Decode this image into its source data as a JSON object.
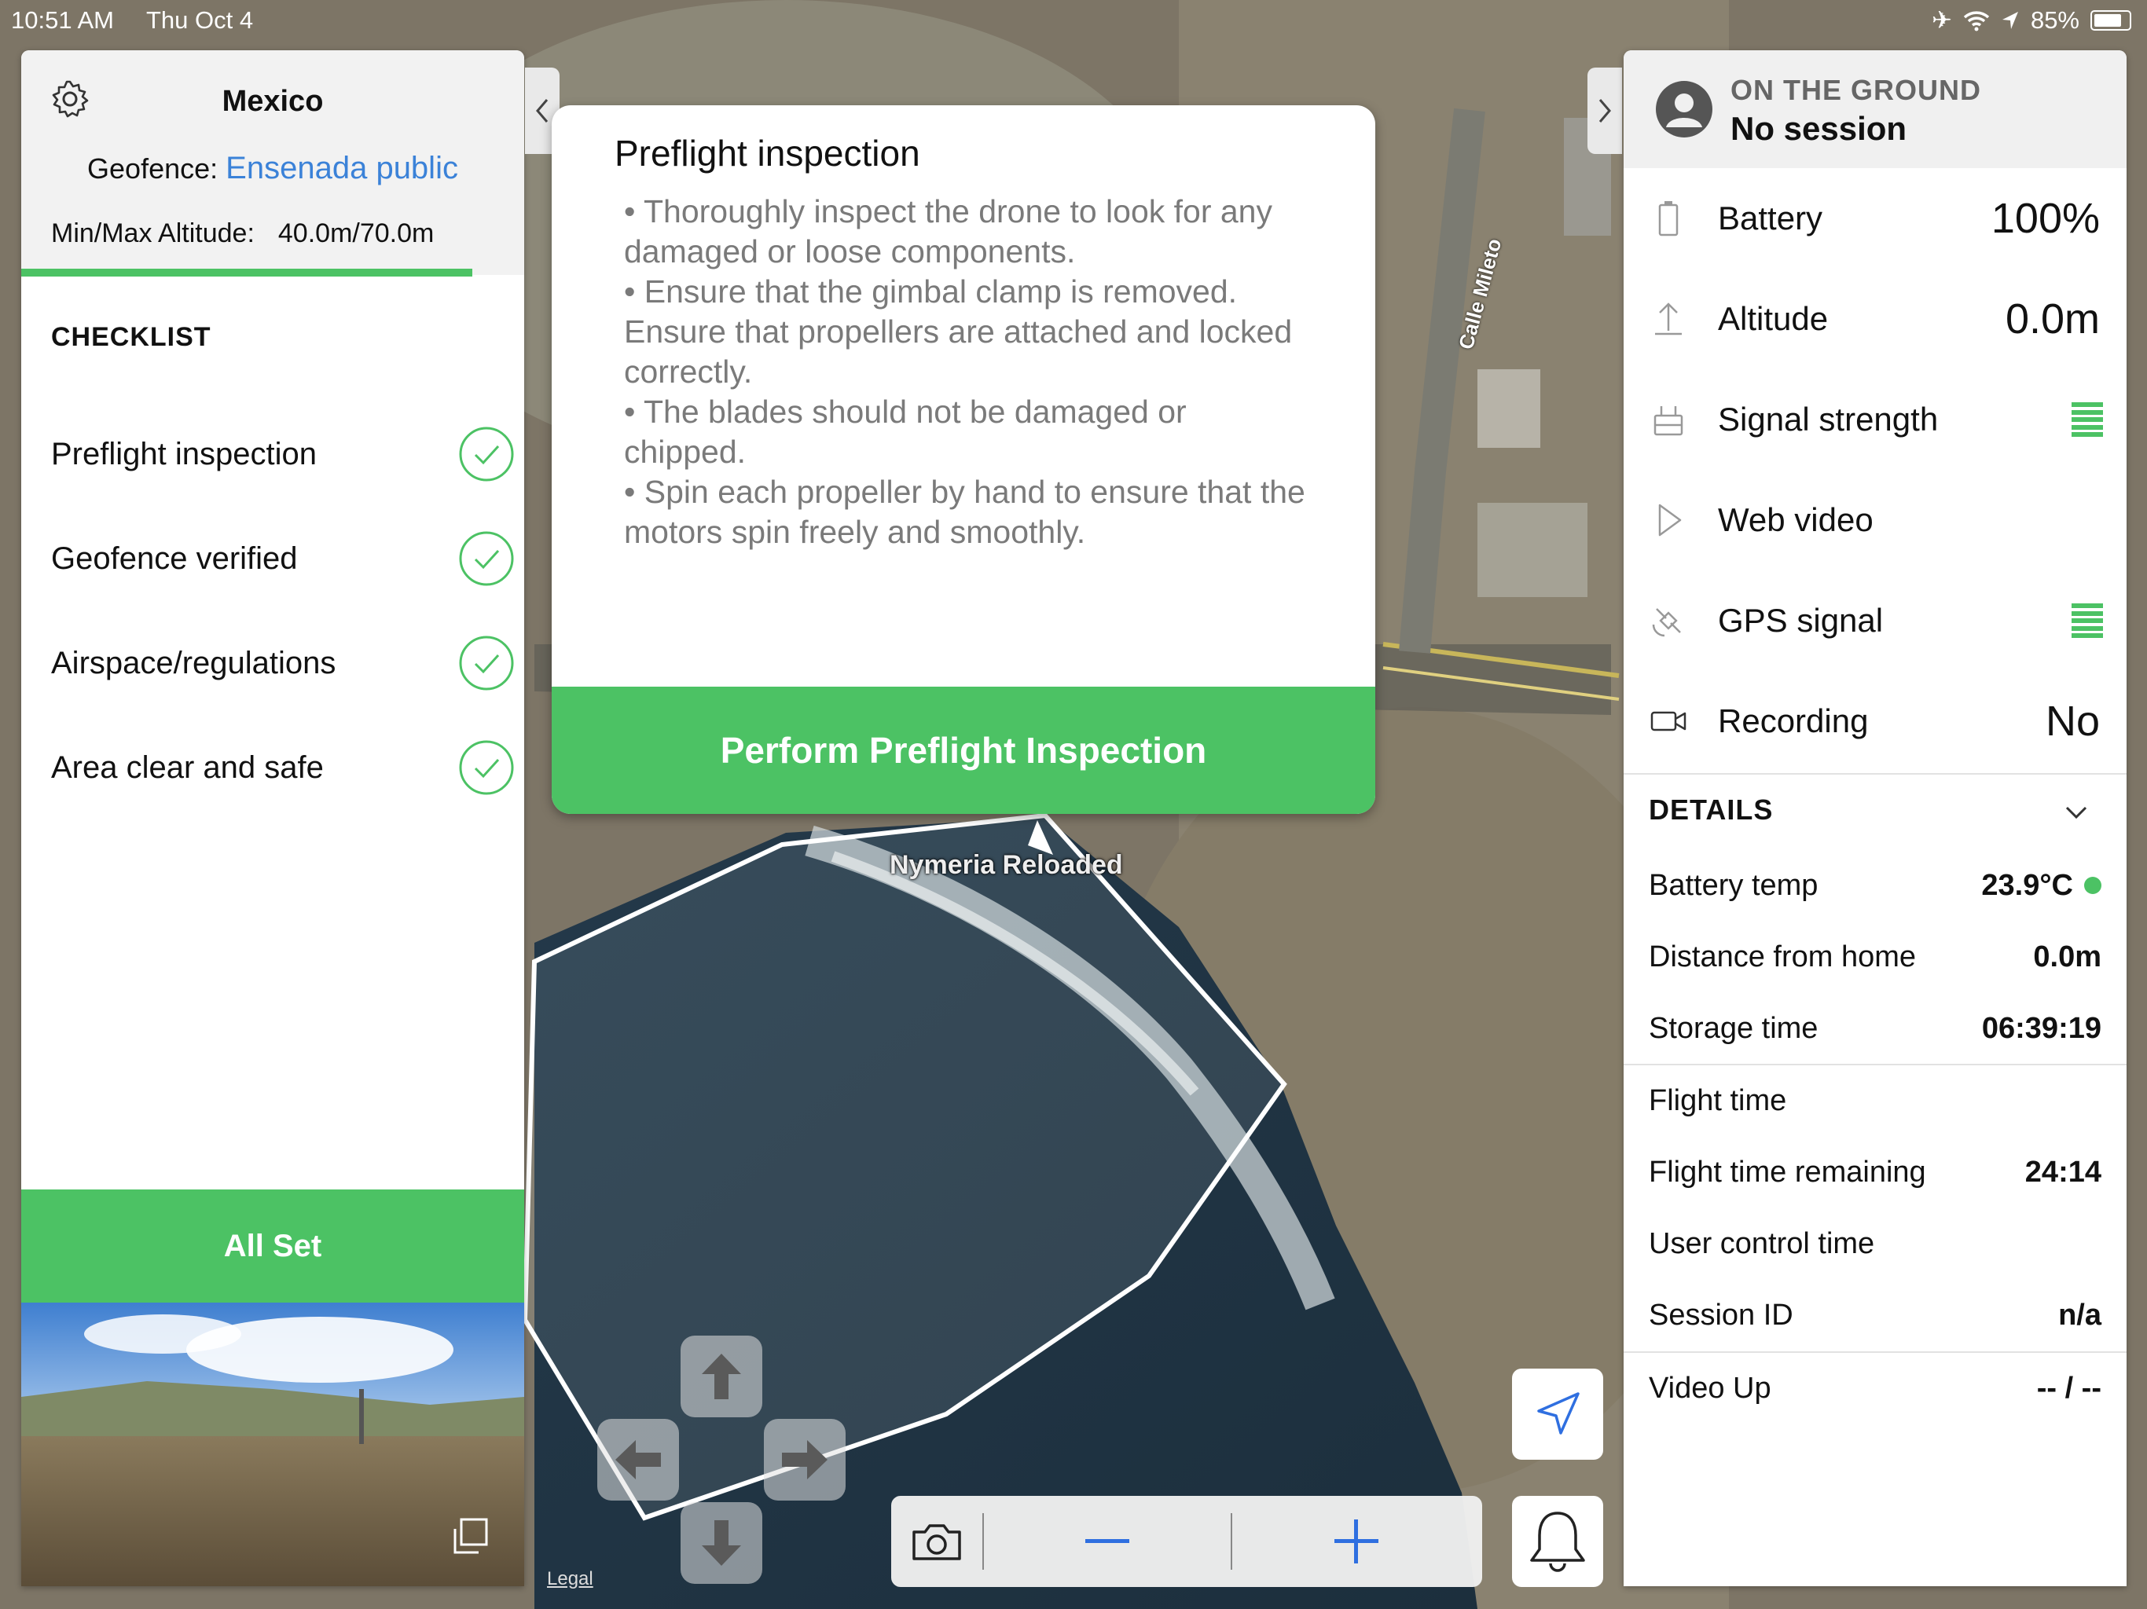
{
  "status_bar": {
    "time": "10:51 AM",
    "date": "Thu Oct 4",
    "battery": "85%"
  },
  "map": {
    "drone_label": "Nymeria Reloaded",
    "street_label": "Calle Mileto",
    "legal": "Legal"
  },
  "left_panel": {
    "title": "Mexico",
    "geofence_label": "Geofence:",
    "geofence_value": "Ensenada public",
    "altitude_label": "Min/Max Altitude:",
    "altitude_value": "40.0m/70.0m",
    "checklist_heading": "CHECKLIST",
    "checklist": [
      {
        "label": "Preflight inspection",
        "checked": true
      },
      {
        "label": "Geofence verified",
        "checked": true
      },
      {
        "label": "Airspace/regulations",
        "checked": true
      },
      {
        "label": "Area clear and safe",
        "checked": true
      }
    ],
    "all_set": "All Set"
  },
  "modal": {
    "title": "Preflight inspection",
    "lines": [
      "• Thoroughly inspect the drone to look for any damaged or loose components.",
      "• Ensure that the gimbal clamp is removed. Ensure that propellers are attached and locked correctly.",
      "• The blades should not be damaged or chipped.",
      "• Spin each propeller by hand to ensure that the motors spin freely and smoothly."
    ],
    "button": "Perform Preflight Inspection"
  },
  "right_panel": {
    "state": "ON THE GROUND",
    "session": "No session",
    "stats": [
      {
        "icon": "battery-icon",
        "label": "Battery",
        "value": "100%"
      },
      {
        "icon": "altitude-icon",
        "label": "Altitude",
        "value": "0.0m"
      },
      {
        "icon": "signal-icon",
        "label": "Signal strength",
        "value": ""
      },
      {
        "icon": "play-icon",
        "label": "Web video",
        "value": ""
      },
      {
        "icon": "gps-icon",
        "label": "GPS signal",
        "value": ""
      },
      {
        "icon": "video-camera-icon",
        "label": "Recording",
        "value": "No"
      }
    ],
    "details_heading": "DETAILS",
    "details": [
      {
        "label": "Battery temp",
        "value": "23.9°C"
      },
      {
        "label": "Distance from home",
        "value": "0.0m"
      },
      {
        "label": "Storage time",
        "value": "06:39:19"
      },
      {
        "label": "Flight time",
        "value": ""
      },
      {
        "label": "Flight time remaining",
        "value": "24:14"
      },
      {
        "label": "User control time",
        "value": ""
      },
      {
        "label": "Session ID",
        "value": "n/a"
      },
      {
        "label": "Video Up",
        "value": "-- / --"
      }
    ]
  },
  "colors": {
    "accent_green": "#4cc264",
    "link_blue": "#3b82d8",
    "zoom_blue": "#2f6fe0"
  }
}
